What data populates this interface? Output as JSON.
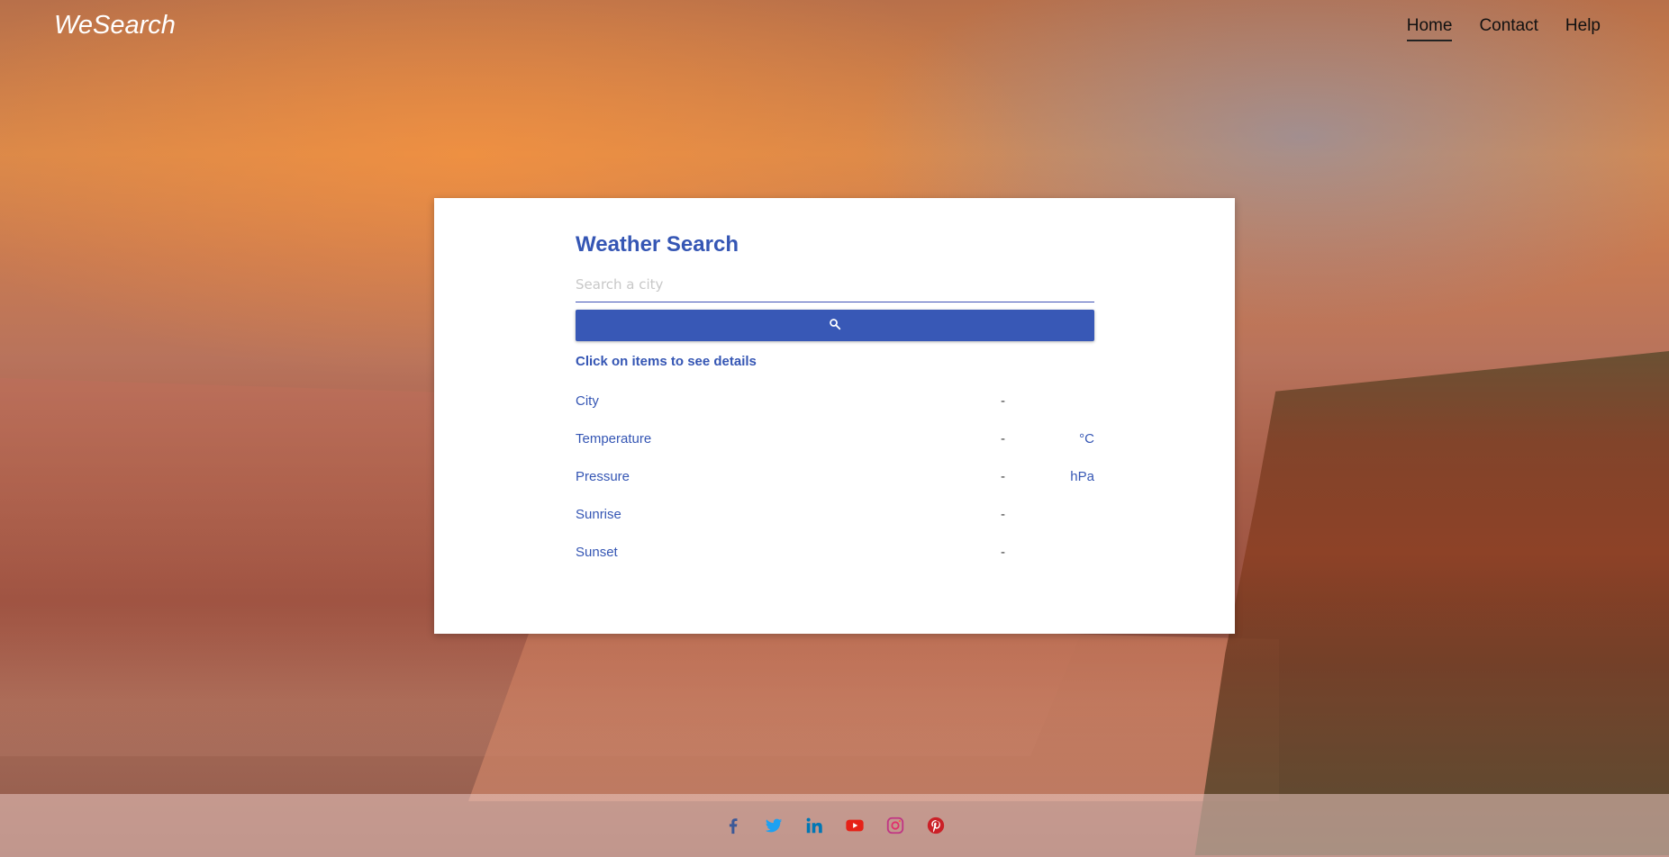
{
  "header": {
    "logo": "WeSearch",
    "nav": [
      {
        "label": "Home",
        "active": true
      },
      {
        "label": "Contact",
        "active": false
      },
      {
        "label": "Help",
        "active": false
      }
    ]
  },
  "card": {
    "title": "Weather Search",
    "search_placeholder": "Search a city",
    "search_value": "",
    "search_button_icon": "search-icon",
    "hint": "Click on items to see details",
    "rows": [
      {
        "label": "City",
        "value": "-",
        "unit": ""
      },
      {
        "label": "Temperature",
        "value": "-",
        "unit": "°C"
      },
      {
        "label": "Pressure",
        "value": "-",
        "unit": "hPa"
      },
      {
        "label": "Sunrise",
        "value": "-",
        "unit": ""
      },
      {
        "label": "Sunset",
        "value": "-",
        "unit": ""
      }
    ]
  },
  "footer": {
    "social": [
      {
        "icon": "facebook-icon",
        "color": "#3b5998"
      },
      {
        "icon": "twitter-icon",
        "color": "#1da1f2"
      },
      {
        "icon": "linkedin-icon",
        "color": "#0077b5"
      },
      {
        "icon": "youtube-icon",
        "color": "#e62117"
      },
      {
        "icon": "instagram-icon",
        "color": "#c13584"
      },
      {
        "icon": "pinterest-icon",
        "color": "#cb2027"
      }
    ]
  },
  "colors": {
    "accent": "#3556b4",
    "button": "#3858b6"
  }
}
